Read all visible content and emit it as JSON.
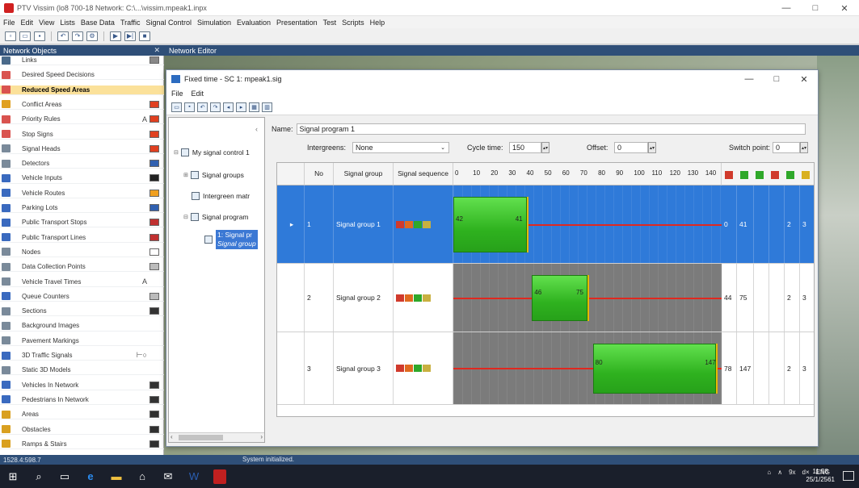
{
  "window": {
    "title": "PTV Vissim (lo8 700-18   Network: C:\\...\\vissim.mpeak1.inpx",
    "controls": [
      "—",
      "□",
      "✕"
    ]
  },
  "menu": [
    "File",
    "Edit",
    "View",
    "Lists",
    "Base Data",
    "Traffic",
    "Signal Control",
    "Simulation",
    "Evaluation",
    "Presentation",
    "Test",
    "Scripts",
    "Help"
  ],
  "network_objects": {
    "header": "Network Objects",
    "items": [
      {
        "label": "Links",
        "color": "#4a6a8a",
        "mark": "",
        "swatch": "#888888"
      },
      {
        "label": "Desired Speed Decisions",
        "color": "#d9534f",
        "mark": "",
        "swatch": ""
      },
      {
        "label": "Reduced Speed Areas",
        "color": "#d9534f",
        "mark": "",
        "swatch": "",
        "selected": true
      },
      {
        "label": "Conflict Areas",
        "color": "#e0a020",
        "mark": "",
        "swatch": "#e04020"
      },
      {
        "label": "Priority Rules",
        "color": "#d9534f",
        "mark": "A",
        "swatch": "#e04020"
      },
      {
        "label": "Stop Signs",
        "color": "#d9534f",
        "mark": "",
        "swatch": "#e04020"
      },
      {
        "label": "Signal Heads",
        "color": "#7a8a9a",
        "mark": "",
        "swatch": "#e04020"
      },
      {
        "label": "Detectors",
        "color": "#7a8a9a",
        "mark": "",
        "swatch": "#3060b0"
      },
      {
        "label": "Vehicle Inputs",
        "color": "#3a6abf",
        "mark": "",
        "swatch": "#222222"
      },
      {
        "label": "Vehicle Routes",
        "color": "#3a6abf",
        "mark": "",
        "swatch": "#f0a020"
      },
      {
        "label": "Parking Lots",
        "color": "#3a6abf",
        "mark": "",
        "swatch": "#3060b0"
      },
      {
        "label": "Public Transport Stops",
        "color": "#3a6abf",
        "mark": "",
        "swatch": "#c03030"
      },
      {
        "label": "Public Transport Lines",
        "color": "#3a6abf",
        "mark": "",
        "swatch": "#c03030"
      },
      {
        "label": "Nodes",
        "color": "#7a8a9a",
        "mark": "",
        "swatch": "#ffffff"
      },
      {
        "label": "Data Collection Points",
        "color": "#7a8a9a",
        "mark": "",
        "swatch": "#bbbbbb"
      },
      {
        "label": "Vehicle Travel Times",
        "color": "#7a8a9a",
        "mark": "A",
        "swatch": ""
      },
      {
        "label": "Queue Counters",
        "color": "#3a6abf",
        "mark": "",
        "swatch": "#bbbbbb"
      },
      {
        "label": "Sections",
        "color": "#7a8a9a",
        "mark": "",
        "swatch": "#333333"
      },
      {
        "label": "Background Images",
        "color": "#7a8a9a",
        "mark": "",
        "swatch": ""
      },
      {
        "label": "Pavement Markings",
        "color": "#7a8a9a",
        "mark": "",
        "swatch": ""
      },
      {
        "label": "3D Traffic Signals",
        "color": "#3a6abf",
        "mark": "⊢○",
        "swatch": ""
      },
      {
        "label": "Static 3D Models",
        "color": "#7a8a9a",
        "mark": "",
        "swatch": ""
      },
      {
        "label": "Vehicles In Network",
        "color": "#3a6abf",
        "mark": "",
        "swatch": "#333333"
      },
      {
        "label": "Pedestrians In Network",
        "color": "#3a6abf",
        "mark": "",
        "swatch": "#333333"
      },
      {
        "label": "Areas",
        "color": "#d9a020",
        "mark": "",
        "swatch": "#303030"
      },
      {
        "label": "Obstacles",
        "color": "#d9a020",
        "mark": "",
        "swatch": "#303030"
      },
      {
        "label": "Ramps & Stairs",
        "color": "#d9a020",
        "mark": "",
        "swatch": "#303030"
      }
    ]
  },
  "network_editor": {
    "header": "Network Editor"
  },
  "dialog": {
    "title": "Fixed time - SC 1: mpeak1.sig",
    "menu": [
      "File",
      "Edit"
    ],
    "tree": {
      "root": "My signal control 1",
      "signal_groups": "Signal groups",
      "intergreen": "Intergreen matr",
      "signal_program": "Signal program",
      "selected_line1": "1: Signal pr",
      "selected_line2": "Signal group"
    },
    "name_label": "Name:",
    "name_value": "Signal program 1",
    "intergreens_label": "Intergreens:",
    "intergreens_value": "None",
    "cycle_label": "Cycle time:",
    "cycle_value": "150",
    "offset_label": "Offset:",
    "offset_value": "0",
    "switch_label": "Switch point:",
    "switch_value": "0",
    "columns": {
      "no": "No",
      "group": "Signal group",
      "sequence": "Signal sequence"
    },
    "timeline_ticks": [
      "0",
      "10",
      "20",
      "30",
      "40",
      "50",
      "60",
      "70",
      "80",
      "90",
      "100",
      "110",
      "120",
      "130",
      "140"
    ],
    "rows": [
      {
        "no": "1",
        "group": "Signal group 1",
        "start": 0,
        "end": 41,
        "start_label": "42",
        "end_label": "41",
        "col1": "0",
        "col2": "41",
        "c5": "2",
        "c6": "3",
        "selected": true
      },
      {
        "no": "2",
        "group": "Signal group 2",
        "start": 44,
        "end": 75,
        "start_label": "46",
        "end_label": "75",
        "col1": "44",
        "col2": "75",
        "c5": "2",
        "c6": "3",
        "selected": false
      },
      {
        "no": "3",
        "group": "Signal group 3",
        "start": 78,
        "end": 147,
        "start_label": "80",
        "end_label": "147",
        "col1": "78",
        "col2": "147",
        "c5": "2",
        "c6": "3",
        "selected": false
      }
    ]
  },
  "status": {
    "coords": "1528.4:598.7",
    "message": "System initialized."
  },
  "taskbar": {
    "tray": [
      "⌂",
      "∧",
      "9x",
      "d×",
      "ENG"
    ],
    "time": "11:58",
    "date": "25/1/2561"
  }
}
